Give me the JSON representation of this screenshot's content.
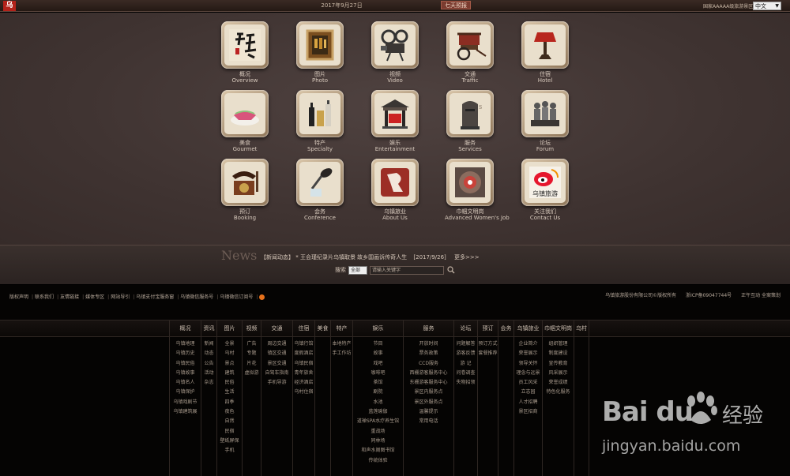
{
  "topbar": {
    "logo": "乌",
    "date": "2017年9月27日",
    "weather": "七天预报",
    "region": "国家AAAAA级旅游景区",
    "language": "中文"
  },
  "tiles": [
    {
      "cn": "概况",
      "en": "Overview",
      "icon": "calligraphy-icon"
    },
    {
      "cn": "图片",
      "en": "Photo",
      "icon": "picture-frame-icon"
    },
    {
      "cn": "视频",
      "en": "Video",
      "icon": "projector-icon"
    },
    {
      "cn": "交通",
      "en": "Traffic",
      "icon": "rickshaw-icon"
    },
    {
      "cn": "住宿",
      "en": "Hotel",
      "icon": "lamp-icon"
    },
    {
      "cn": "美食",
      "en": "Gourmet",
      "icon": "cake-icon"
    },
    {
      "cn": "特产",
      "en": "Specialty",
      "icon": "bottles-icon"
    },
    {
      "cn": "娱乐",
      "en": "Entertainment",
      "icon": "stage-icon"
    },
    {
      "cn": "服务",
      "en": "Services",
      "icon": "mailbox-icon"
    },
    {
      "cn": "论坛",
      "en": "Forum",
      "icon": "figurines-icon"
    },
    {
      "cn": "预订",
      "en": "Booking",
      "icon": "telephone-icon"
    },
    {
      "cn": "会务",
      "en": "Conference",
      "icon": "microphone-icon"
    },
    {
      "cn": "乌镇旅业",
      "en": "About Us",
      "icon": "brand-logo-icon"
    },
    {
      "cn": "巾帼文明岗",
      "en": "Advanced Women's Job",
      "icon": "emblem-icon"
    },
    {
      "cn": "关注我们",
      "en": "Contact Us",
      "icon": "weibo-icon"
    }
  ],
  "weibo_label": "乌镇旅游",
  "news": {
    "title": "News",
    "category": "【新闻动态】",
    "headline": "* 王会瑾纪录片乌镇取景 故乡国画诉传奇人生",
    "date": "[2017/9/26]",
    "more": "更多>>>"
  },
  "search": {
    "label": "搜索",
    "scope": "全部",
    "placeholder": "请输入关键字"
  },
  "footer": {
    "links": [
      "版权声明",
      "联系我们",
      "友情链接",
      "媒体专区",
      "网站导引",
      "乌镇支付宝服务窗",
      "乌镇微信服务号",
      "乌镇微信订阅号"
    ],
    "company": "乌镇旅游股份有限公司©版权所有",
    "icp": "浙ICP备09047744号",
    "designer": "正午互动 全案策划"
  },
  "sitemap": [
    {
      "h": "概况",
      "w": 40,
      "cols": [
        [
          "乌镇地理",
          "乌镇历史",
          "乌镇民俗",
          "乌镇故事",
          "乌镇名人",
          "乌镇保护",
          "乌镇戏剧节",
          "乌镇建筑展"
        ]
      ]
    },
    {
      "h": "资讯",
      "w": 20,
      "cols": [
        [
          "新闻",
          "动态",
          "公告",
          "活动",
          "杂志"
        ]
      ]
    },
    {
      "h": "图片",
      "w": 32,
      "cols": [
        [
          "全景",
          "乌村",
          "景点",
          "建筑",
          "民俗",
          "生活",
          "四季",
          "夜色",
          "自然",
          "民宿",
          "壁纸屏保",
          "手机"
        ]
      ]
    },
    {
      "h": "视频",
      "w": 24,
      "cols": [
        [
          "广告",
          "专题",
          "片花",
          "虚拟游"
        ]
      ]
    },
    {
      "h": "交通",
      "w": 40,
      "cols": [
        [
          "周边交通",
          "镇区交通",
          "景区交通",
          "自驾车指南",
          "手机导游"
        ]
      ]
    },
    {
      "h": "住宿",
      "w": 28,
      "cols": [
        [
          "乌镇行馆",
          "度假酒店",
          "乌镇民宿",
          "青年旅舍",
          "经济酒店",
          "乌村住宿"
        ]
      ]
    },
    {
      "h": "美食",
      "w": 20,
      "cols": [
        []
      ]
    },
    {
      "h": "特产",
      "w": 28,
      "cols": [
        [
          "本地特产",
          "手工作坊"
        ]
      ]
    },
    {
      "h": "娱乐",
      "w": 64,
      "cols": [
        [
          "节目",
          "故事",
          "戏吧",
          "咖啡吧",
          "茶馆",
          "剧院",
          "水池",
          "蓝莲瑜伽",
          "道禅SPA水疗养生馆",
          "重战场",
          "同林场",
          "和声水阁图书馆",
          "传统体验"
        ]
      ]
    },
    {
      "h": "服务",
      "w": 64,
      "cols": [
        [
          "开放时间",
          "票务政策",
          "CCD服务",
          "西栅游客服务中心",
          "东栅游客服务中心",
          "景区内服务点",
          "景区外服务点",
          "温馨提示",
          "常用电话"
        ]
      ]
    },
    {
      "h": "论坛",
      "w": 30,
      "cols": [
        [
          "问题解答",
          "游客反馈",
          "游 记",
          "问卷调查",
          "失物招领"
        ]
      ]
    },
    {
      "h": "预订",
      "w": 26,
      "cols": [
        [
          "预订方式",
          "套餐推荐"
        ]
      ]
    },
    {
      "h": "会务",
      "w": 20,
      "cols": [
        []
      ]
    },
    {
      "h": "乌镇旅业",
      "w": 36,
      "cols": [
        [
          "企业简介",
          "荣誉展示",
          "领导关怀",
          "理念与远景",
          "员工风采",
          "立志园",
          "人才招聘",
          "景区招商"
        ]
      ]
    },
    {
      "h": "巾帼文明岗",
      "w": 40,
      "cols": [
        [
          "组织管理",
          "制度建设",
          "宣传教育",
          "风采展示",
          "荣誉成绩",
          "特色化服务"
        ]
      ]
    },
    {
      "h": "乌村",
      "w": 20,
      "cols": [
        []
      ]
    }
  ],
  "watermark": {
    "brand": "Bai du",
    "cn": "经验",
    "url": "jingyan.baidu.com"
  }
}
